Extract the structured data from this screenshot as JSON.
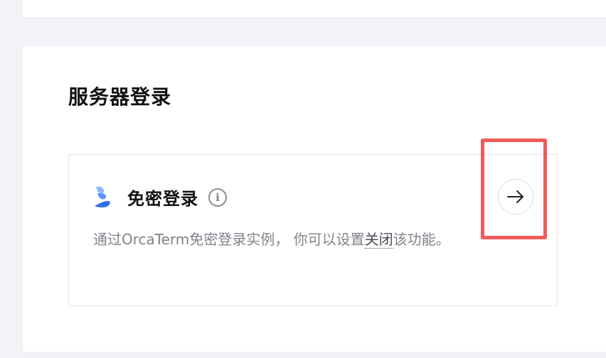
{
  "section": {
    "title": "服务器登录"
  },
  "card": {
    "title": "免密登录",
    "description_prefix": "通过OrcaTerm免密登录实例，  你可以设置",
    "description_link": "关闭",
    "description_suffix": "该功能。",
    "info_icon_glyph": "i",
    "logo_icon": "orcaterm-logo-icon",
    "arrow_icon": "arrow-right-icon"
  },
  "colors": {
    "highlight": "#f25a5a",
    "logo_blue": "#3d7cf0",
    "logo_light": "#8fb7ff"
  }
}
